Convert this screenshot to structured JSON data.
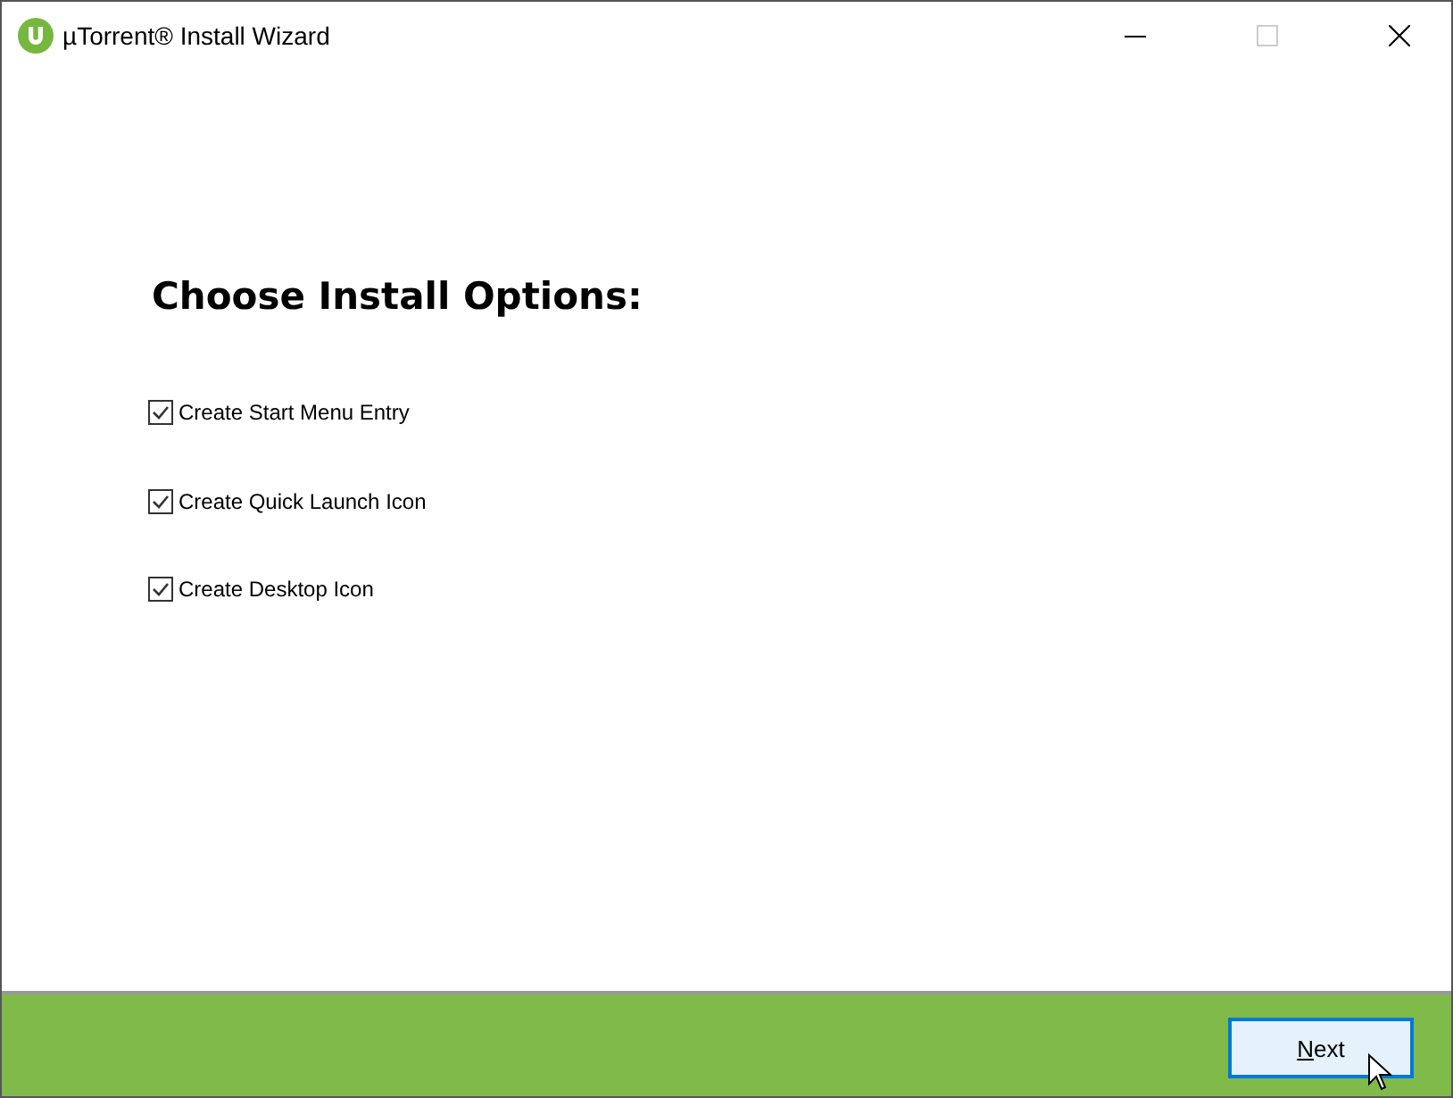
{
  "window": {
    "title": "µTorrent® Install Wizard"
  },
  "heading": "Choose Install Options:",
  "options": [
    {
      "label": "Create Start Menu Entry",
      "checked": true
    },
    {
      "label": "Create Quick Launch Icon",
      "checked": true
    },
    {
      "label": "Create Desktop Icon",
      "checked": true
    }
  ],
  "buttons": [
    {
      "label": "Next",
      "focused": true
    }
  ]
}
